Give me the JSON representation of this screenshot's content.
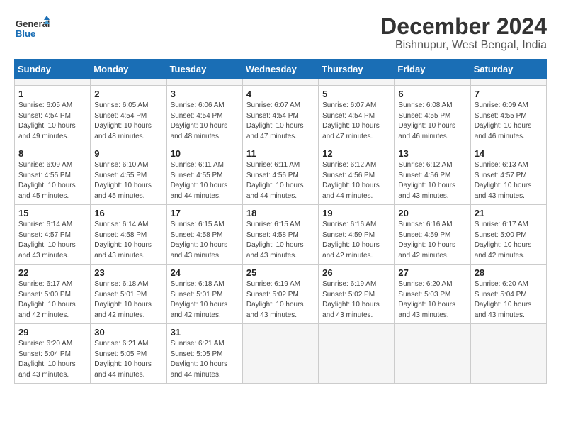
{
  "header": {
    "logo_line1": "General",
    "logo_line2": "Blue",
    "title": "December 2024",
    "subtitle": "Bishnupur, West Bengal, India"
  },
  "calendar": {
    "weekdays": [
      "Sunday",
      "Monday",
      "Tuesday",
      "Wednesday",
      "Thursday",
      "Friday",
      "Saturday"
    ],
    "weeks": [
      [
        {
          "day": "",
          "empty": true
        },
        {
          "day": "",
          "empty": true
        },
        {
          "day": "",
          "empty": true
        },
        {
          "day": "",
          "empty": true
        },
        {
          "day": "",
          "empty": true
        },
        {
          "day": "",
          "empty": true
        },
        {
          "day": "",
          "empty": true
        }
      ],
      [
        {
          "day": "1",
          "sunrise": "Sunrise: 6:05 AM",
          "sunset": "Sunset: 4:54 PM",
          "daylight": "Daylight: 10 hours and 49 minutes."
        },
        {
          "day": "2",
          "sunrise": "Sunrise: 6:05 AM",
          "sunset": "Sunset: 4:54 PM",
          "daylight": "Daylight: 10 hours and 48 minutes."
        },
        {
          "day": "3",
          "sunrise": "Sunrise: 6:06 AM",
          "sunset": "Sunset: 4:54 PM",
          "daylight": "Daylight: 10 hours and 48 minutes."
        },
        {
          "day": "4",
          "sunrise": "Sunrise: 6:07 AM",
          "sunset": "Sunset: 4:54 PM",
          "daylight": "Daylight: 10 hours and 47 minutes."
        },
        {
          "day": "5",
          "sunrise": "Sunrise: 6:07 AM",
          "sunset": "Sunset: 4:54 PM",
          "daylight": "Daylight: 10 hours and 47 minutes."
        },
        {
          "day": "6",
          "sunrise": "Sunrise: 6:08 AM",
          "sunset": "Sunset: 4:55 PM",
          "daylight": "Daylight: 10 hours and 46 minutes."
        },
        {
          "day": "7",
          "sunrise": "Sunrise: 6:09 AM",
          "sunset": "Sunset: 4:55 PM",
          "daylight": "Daylight: 10 hours and 46 minutes."
        }
      ],
      [
        {
          "day": "8",
          "sunrise": "Sunrise: 6:09 AM",
          "sunset": "Sunset: 4:55 PM",
          "daylight": "Daylight: 10 hours and 45 minutes."
        },
        {
          "day": "9",
          "sunrise": "Sunrise: 6:10 AM",
          "sunset": "Sunset: 4:55 PM",
          "daylight": "Daylight: 10 hours and 45 minutes."
        },
        {
          "day": "10",
          "sunrise": "Sunrise: 6:11 AM",
          "sunset": "Sunset: 4:55 PM",
          "daylight": "Daylight: 10 hours and 44 minutes."
        },
        {
          "day": "11",
          "sunrise": "Sunrise: 6:11 AM",
          "sunset": "Sunset: 4:56 PM",
          "daylight": "Daylight: 10 hours and 44 minutes."
        },
        {
          "day": "12",
          "sunrise": "Sunrise: 6:12 AM",
          "sunset": "Sunset: 4:56 PM",
          "daylight": "Daylight: 10 hours and 44 minutes."
        },
        {
          "day": "13",
          "sunrise": "Sunrise: 6:12 AM",
          "sunset": "Sunset: 4:56 PM",
          "daylight": "Daylight: 10 hours and 43 minutes."
        },
        {
          "day": "14",
          "sunrise": "Sunrise: 6:13 AM",
          "sunset": "Sunset: 4:57 PM",
          "daylight": "Daylight: 10 hours and 43 minutes."
        }
      ],
      [
        {
          "day": "15",
          "sunrise": "Sunrise: 6:14 AM",
          "sunset": "Sunset: 4:57 PM",
          "daylight": "Daylight: 10 hours and 43 minutes."
        },
        {
          "day": "16",
          "sunrise": "Sunrise: 6:14 AM",
          "sunset": "Sunset: 4:58 PM",
          "daylight": "Daylight: 10 hours and 43 minutes."
        },
        {
          "day": "17",
          "sunrise": "Sunrise: 6:15 AM",
          "sunset": "Sunset: 4:58 PM",
          "daylight": "Daylight: 10 hours and 43 minutes."
        },
        {
          "day": "18",
          "sunrise": "Sunrise: 6:15 AM",
          "sunset": "Sunset: 4:58 PM",
          "daylight": "Daylight: 10 hours and 43 minutes."
        },
        {
          "day": "19",
          "sunrise": "Sunrise: 6:16 AM",
          "sunset": "Sunset: 4:59 PM",
          "daylight": "Daylight: 10 hours and 42 minutes."
        },
        {
          "day": "20",
          "sunrise": "Sunrise: 6:16 AM",
          "sunset": "Sunset: 4:59 PM",
          "daylight": "Daylight: 10 hours and 42 minutes."
        },
        {
          "day": "21",
          "sunrise": "Sunrise: 6:17 AM",
          "sunset": "Sunset: 5:00 PM",
          "daylight": "Daylight: 10 hours and 42 minutes."
        }
      ],
      [
        {
          "day": "22",
          "sunrise": "Sunrise: 6:17 AM",
          "sunset": "Sunset: 5:00 PM",
          "daylight": "Daylight: 10 hours and 42 minutes."
        },
        {
          "day": "23",
          "sunrise": "Sunrise: 6:18 AM",
          "sunset": "Sunset: 5:01 PM",
          "daylight": "Daylight: 10 hours and 42 minutes."
        },
        {
          "day": "24",
          "sunrise": "Sunrise: 6:18 AM",
          "sunset": "Sunset: 5:01 PM",
          "daylight": "Daylight: 10 hours and 42 minutes."
        },
        {
          "day": "25",
          "sunrise": "Sunrise: 6:19 AM",
          "sunset": "Sunset: 5:02 PM",
          "daylight": "Daylight: 10 hours and 43 minutes."
        },
        {
          "day": "26",
          "sunrise": "Sunrise: 6:19 AM",
          "sunset": "Sunset: 5:02 PM",
          "daylight": "Daylight: 10 hours and 43 minutes."
        },
        {
          "day": "27",
          "sunrise": "Sunrise: 6:20 AM",
          "sunset": "Sunset: 5:03 PM",
          "daylight": "Daylight: 10 hours and 43 minutes."
        },
        {
          "day": "28",
          "sunrise": "Sunrise: 6:20 AM",
          "sunset": "Sunset: 5:04 PM",
          "daylight": "Daylight: 10 hours and 43 minutes."
        }
      ],
      [
        {
          "day": "29",
          "sunrise": "Sunrise: 6:20 AM",
          "sunset": "Sunset: 5:04 PM",
          "daylight": "Daylight: 10 hours and 43 minutes."
        },
        {
          "day": "30",
          "sunrise": "Sunrise: 6:21 AM",
          "sunset": "Sunset: 5:05 PM",
          "daylight": "Daylight: 10 hours and 44 minutes."
        },
        {
          "day": "31",
          "sunrise": "Sunrise: 6:21 AM",
          "sunset": "Sunset: 5:05 PM",
          "daylight": "Daylight: 10 hours and 44 minutes."
        },
        {
          "day": "",
          "empty": true
        },
        {
          "day": "",
          "empty": true
        },
        {
          "day": "",
          "empty": true
        },
        {
          "day": "",
          "empty": true
        }
      ]
    ]
  }
}
